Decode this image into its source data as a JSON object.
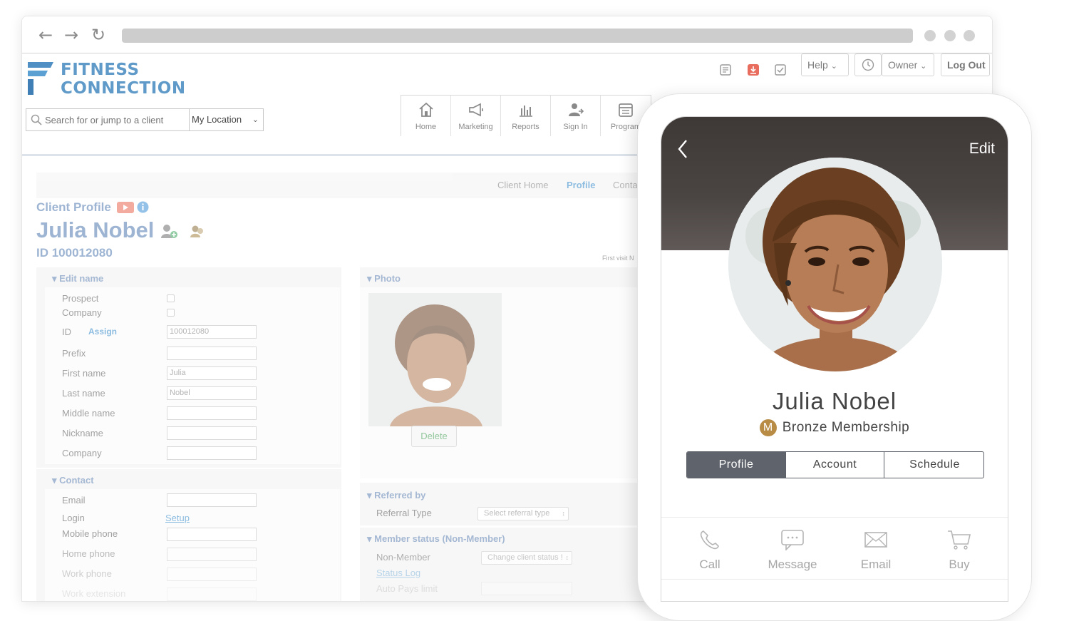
{
  "app": {
    "brand": {
      "line1": "FITNESS",
      "line2": "CONNECTION",
      "color": "#5f9ac9"
    },
    "top_actions": {
      "icons": [
        "newspaper-icon",
        "inbox-download-icon",
        "checklist-icon",
        "clock-icon"
      ],
      "help": "Help",
      "owner": "Owner",
      "logout": "Log Out"
    },
    "search": {
      "placeholder": "Search for or jump to a client",
      "location": "My Location"
    },
    "nav": [
      {
        "label": "Home",
        "icon": "home-icon"
      },
      {
        "label": "Marketing",
        "icon": "megaphone-icon"
      },
      {
        "label": "Reports",
        "icon": "bar-chart-icon"
      },
      {
        "label": "Sign In",
        "icon": "user-arrow-icon"
      },
      {
        "label": "Program",
        "icon": "calendar-icon"
      }
    ],
    "subtabs": [
      "Client Home",
      "Profile",
      "Conta"
    ],
    "client": {
      "section_label": "Client Profile",
      "name": "Julia Nobel",
      "id": "ID 100012080",
      "first_visit": "First visit N"
    },
    "edit_name": {
      "title": "Edit name",
      "prospect": "Prospect",
      "company_check": "Company",
      "id_label": "ID",
      "assign": "Assign",
      "id_value": "100012080",
      "prefix": "Prefix",
      "first_name": "First name",
      "first_name_value": "Julia",
      "last_name": "Last name",
      "last_name_value": "Nobel",
      "middle_name": "Middle name",
      "nickname": "Nickname",
      "company": "Company"
    },
    "contact": {
      "title": "Contact",
      "email": "Email",
      "login": "Login",
      "setup": "Setup",
      "mobile": "Mobile phone",
      "home": "Home phone",
      "work": "Work phone",
      "work_ext": "Work extension"
    },
    "photo": {
      "title": "Photo",
      "delete": "Delete"
    },
    "referred": {
      "title": "Referred by",
      "type_label": "Referral Type",
      "select": "Select referral type"
    },
    "member_status": {
      "title": "Member status (Non-Member)",
      "non_member": "Non-Member",
      "change": "Change client status !",
      "status_log": "Status Log",
      "autopays": "Auto Pays limit"
    }
  },
  "phone": {
    "edit": "Edit",
    "name": "Julia Nobel",
    "badge_letter": "M",
    "membership": "Bronze Membership",
    "badge_color": "#b88c45",
    "tabs": [
      "Profile",
      "Account",
      "Schedule"
    ],
    "active_tab": "Profile",
    "actions": [
      {
        "label": "Call",
        "icon": "phone-icon"
      },
      {
        "label": "Message",
        "icon": "chat-bubble-icon"
      },
      {
        "label": "Email",
        "icon": "envelope-icon"
      },
      {
        "label": "Buy",
        "icon": "cart-icon"
      }
    ]
  }
}
